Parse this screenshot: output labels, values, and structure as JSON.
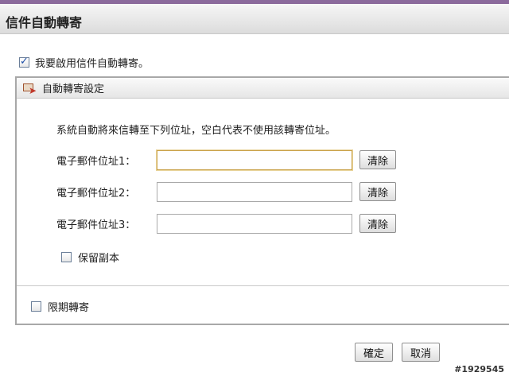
{
  "header": {
    "title": "信件自動轉寄"
  },
  "enable": {
    "label": "我要啟用信件自動轉寄。",
    "checked": true
  },
  "panel": {
    "title": "自動轉寄設定",
    "description": "系統自動將來信轉至下列位址，空白代表不使用該轉寄位址。",
    "fields": [
      {
        "label": "電子郵件位址1：",
        "value": "",
        "clear_label": "清除"
      },
      {
        "label": "電子郵件位址2：",
        "value": "",
        "clear_label": "清除"
      },
      {
        "label": "電子郵件位址3：",
        "value": "",
        "clear_label": "清除"
      }
    ],
    "keep_copy": {
      "label": "保留副本",
      "checked": false
    },
    "limit": {
      "label": "限期轉寄",
      "checked": false
    }
  },
  "actions": {
    "confirm_label": "確定",
    "cancel_label": "取消"
  },
  "watermark": "#1929545",
  "colors": {
    "header_accent": "#8b6a9c",
    "focus_border": "#c9a24a"
  },
  "icons": {
    "panel_icon": "mail-forward-icon"
  }
}
